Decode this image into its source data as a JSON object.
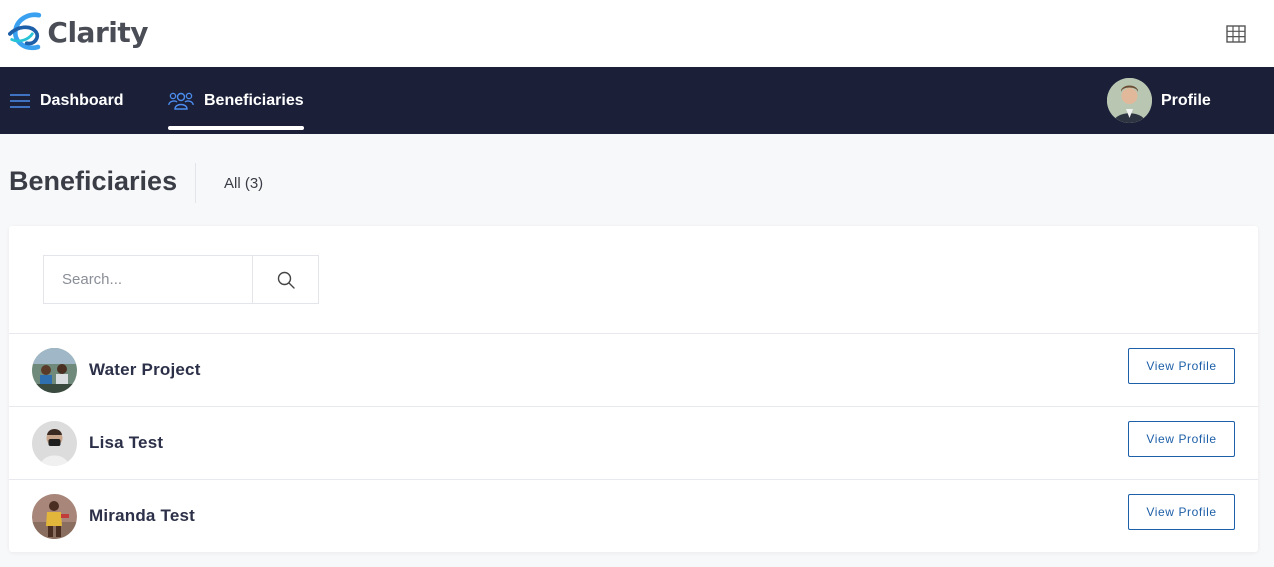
{
  "app": {
    "name": "Clarity"
  },
  "header": {
    "apps_icon": "grid-icon"
  },
  "nav": {
    "items": [
      {
        "label": "Dashboard",
        "icon": "menu-icon"
      },
      {
        "label": "Beneficiaries",
        "icon": "users-icon",
        "active": true
      }
    ],
    "profile": {
      "label": "Profile",
      "icon": "avatar"
    }
  },
  "page": {
    "title": "Beneficiaries",
    "filter_label": "All (3)"
  },
  "search": {
    "placeholder": "Search...",
    "value": ""
  },
  "beneficiaries": [
    {
      "name": "Water Project",
      "action": "View Profile"
    },
    {
      "name": "Lisa Test",
      "action": "View Profile"
    },
    {
      "name": "Miranda Test",
      "action": "View Profile"
    }
  ],
  "colors": {
    "navbar_bg": "#1b2038",
    "accent_blue": "#1d5fa8",
    "logo_blue": "#3aa0f0"
  }
}
